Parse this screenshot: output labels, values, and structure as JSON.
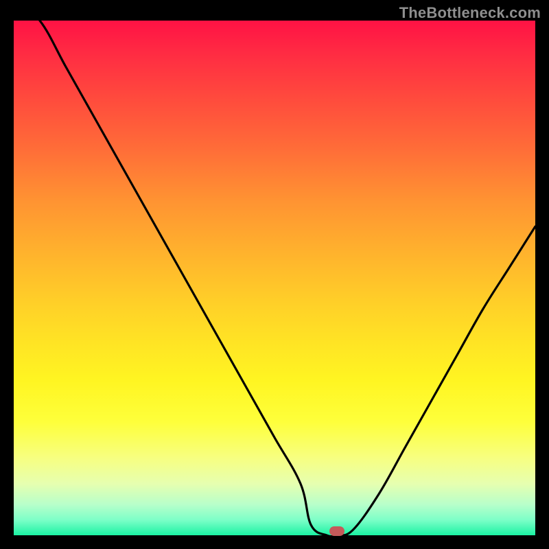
{
  "watermark": "TheBottleneck.com",
  "colors": {
    "page_bg": "#000000",
    "watermark_text": "#8f8f8f",
    "curve": "#000000",
    "marker": "#c55a5a",
    "gradient_top": "#ff1244",
    "gradient_bottom": "#1bf2a3"
  },
  "chart_data": {
    "type": "line",
    "title": "",
    "xlabel": "",
    "ylabel": "",
    "xlim": [
      0,
      100
    ],
    "ylim": [
      0,
      100
    ],
    "legend": false,
    "grid": false,
    "top_segment_end_x": 5,
    "minimum": {
      "x": 62,
      "y": 0
    },
    "flat_segment": {
      "x_start": 57,
      "x_end": 65,
      "y": 0
    },
    "right_end": {
      "x": 100,
      "y": 60
    },
    "series": [
      {
        "name": "bottleneck-curve",
        "x": [
          0,
          5,
          10,
          15,
          20,
          25,
          30,
          35,
          40,
          45,
          50,
          55,
          57,
          60,
          62,
          65,
          70,
          75,
          80,
          85,
          90,
          95,
          100
        ],
        "values": [
          105,
          100,
          91,
          82,
          73,
          64,
          55,
          46,
          37,
          28,
          19,
          10,
          2,
          0,
          0,
          1,
          8,
          17,
          26,
          35,
          44,
          52,
          60
        ]
      }
    ],
    "marker_point": {
      "x": 62,
      "y": 0
    }
  }
}
